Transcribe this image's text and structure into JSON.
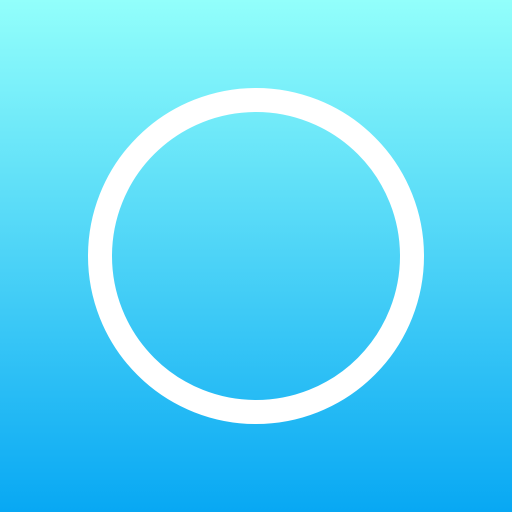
{
  "icon": {
    "name": "ring-icon",
    "gradient_top": "#92FFFB",
    "gradient_bottom": "#08A8F3",
    "ring_color": "#FFFFFF"
  }
}
